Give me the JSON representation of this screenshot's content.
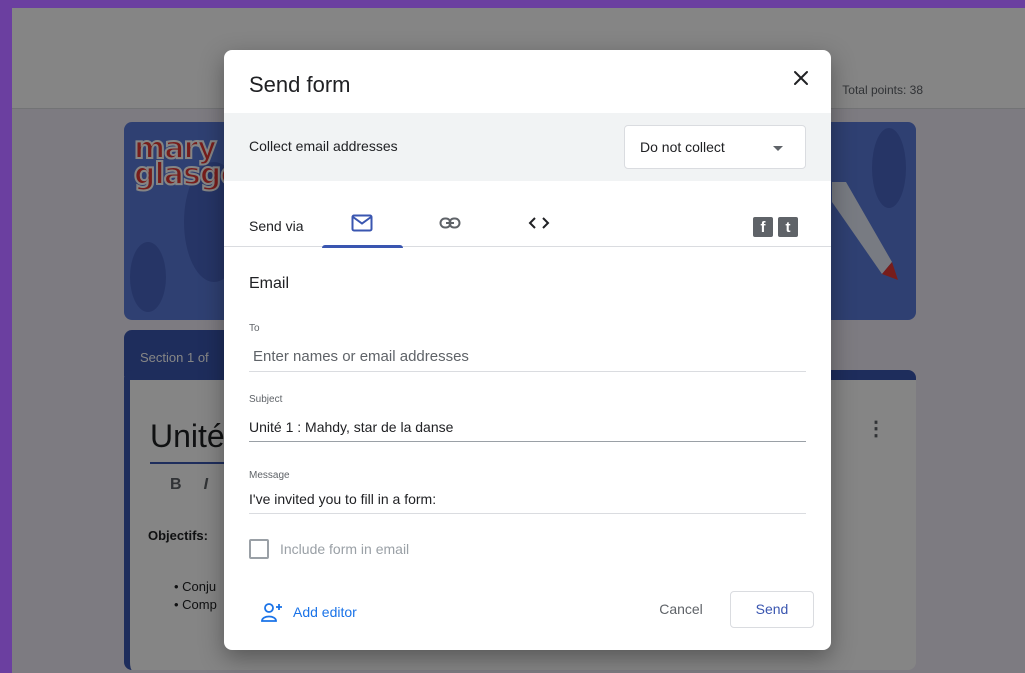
{
  "background": {
    "total_points": "Total points: 38",
    "logo_line1": "mary",
    "logo_line2": "glasgo",
    "section_label": "Section 1 of",
    "form_title": "Unité",
    "toolbar_bold": "B",
    "toolbar_italic": "I",
    "objectifs_label": "Objectifs:",
    "bullets": [
      "• Conju",
      "• Comp"
    ],
    "kebab": "⋮"
  },
  "dialog": {
    "title": "Send form",
    "close_icon": "close-icon",
    "collect": {
      "label": "Collect email addresses",
      "selected": "Do not collect"
    },
    "send_via": {
      "label": "Send via",
      "tabs": [
        {
          "icon": "email-icon",
          "active": true
        },
        {
          "icon": "link-icon",
          "active": false
        },
        {
          "icon": "embed-icon",
          "active": false
        }
      ],
      "social": [
        {
          "icon": "facebook-icon",
          "glyph": "f"
        },
        {
          "icon": "twitter-icon",
          "glyph": "t"
        }
      ]
    },
    "email": {
      "heading": "Email",
      "to_label": "To",
      "to_placeholder": "Enter names or email addresses",
      "subject_label": "Subject",
      "subject_value": "Unité 1 : Mahdy, star de la danse",
      "message_label": "Message",
      "message_value": "I've invited you to fill in a form:",
      "include_label": "Include form in email"
    },
    "footer": {
      "add_editor": "Add editor",
      "cancel": "Cancel",
      "send": "Send"
    }
  },
  "colors": {
    "accent": "#3a56b0",
    "link": "#1a73e8",
    "backdrop": "#6b3fa0"
  }
}
